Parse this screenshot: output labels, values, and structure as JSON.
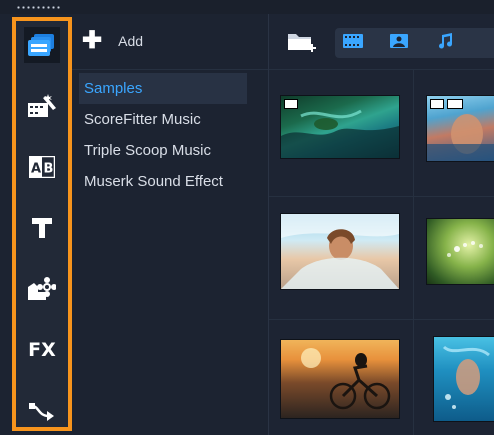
{
  "toolbar": {
    "add_label": "Add"
  },
  "library": {
    "items": [
      {
        "label": "Samples",
        "selected": true
      },
      {
        "label": "ScoreFitter Music",
        "selected": false
      },
      {
        "label": "Triple Scoop Music",
        "selected": false
      },
      {
        "label": "Muserk Sound Effect",
        "selected": false
      }
    ]
  },
  "rail": {
    "items": [
      {
        "name": "media",
        "icon": "media-library-icon",
        "active": true
      },
      {
        "name": "instant-project",
        "icon": "instant-project-icon",
        "active": false
      },
      {
        "name": "transition",
        "icon": "transition-icon",
        "text": "AB",
        "active": false
      },
      {
        "name": "title",
        "icon": "title-icon",
        "text": "T",
        "active": false
      },
      {
        "name": "graphics",
        "icon": "graphics-icon",
        "active": false
      },
      {
        "name": "filter",
        "icon": "fx-icon",
        "text": "FX",
        "active": false
      },
      {
        "name": "path",
        "icon": "motion-path-icon",
        "active": false
      }
    ]
  },
  "media_filters": [
    "video-filter-icon",
    "photo-filter-icon",
    "music-filter-icon"
  ],
  "colors": {
    "accent": "#3aa6ff",
    "rail_highlight": "#f7941d",
    "background": "#1c2331"
  }
}
